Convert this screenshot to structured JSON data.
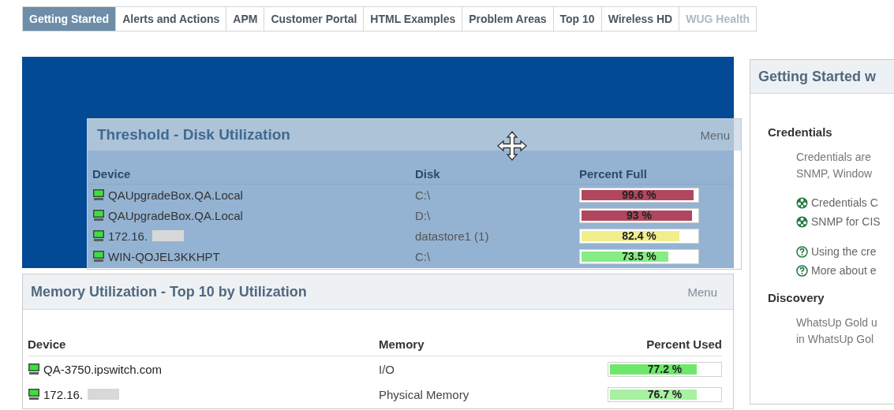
{
  "tabs": [
    {
      "label": "Getting Started",
      "selected": true
    },
    {
      "label": "Alerts and Actions",
      "selected": false
    },
    {
      "label": "APM",
      "selected": false
    },
    {
      "label": "Customer Portal",
      "selected": false
    },
    {
      "label": "HTML Examples",
      "selected": false
    },
    {
      "label": "Problem Areas",
      "selected": false
    },
    {
      "label": "Top 10",
      "selected": false
    },
    {
      "label": "Wireless HD",
      "selected": false
    },
    {
      "label": "WUG Health",
      "selected": false
    }
  ],
  "memory_panel": {
    "title": "Memory Utilization - Top 10 by Utilization",
    "menu": "Menu",
    "columns": [
      "Device",
      "Memory",
      "Percent Used"
    ],
    "rows": [
      {
        "device": "QA-3750.ipswitch.com",
        "redacted": false,
        "memory": "I/O",
        "reading": "77.2 %",
        "level": 0.772,
        "color": "#6ee86a"
      },
      {
        "device": "172.16.",
        "redacted": true,
        "memory": "Physical Memory",
        "reading": "76.7 %",
        "level": 0.767,
        "color": "#a8f0a2"
      }
    ]
  },
  "getting_started_panel": {
    "title": "Getting Started w",
    "sections": [
      {
        "heading": "Credentials",
        "lines": [
          "Credentials are",
          "SNMP, Window"
        ],
        "link_groups": [
          {
            "links": [
              {
                "kind": "video",
                "text": "Credentials C"
              },
              {
                "kind": "video",
                "text": "SNMP for CIS"
              }
            ]
          },
          {
            "links": [
              {
                "kind": "help",
                "text": "Using the cre"
              },
              {
                "kind": "help",
                "text": "More about e"
              }
            ]
          }
        ]
      },
      {
        "heading": "Discovery",
        "lines": [
          "WhatsUp Gold u",
          "in WhatsUp Gol"
        ]
      }
    ]
  },
  "floating_panel": {
    "title": "Threshold - Disk Utilization",
    "menu": "Menu",
    "columns": [
      "Device",
      "Disk",
      "Percent Full"
    ],
    "rows": [
      {
        "device": "QAUpgradeBox.QA.Local",
        "redacted": false,
        "disk": "C:\\",
        "reading": "99.6 %",
        "level": 0.996,
        "color": "#b0475e"
      },
      {
        "device": "QAUpgradeBox.QA.Local",
        "redacted": false,
        "disk": "D:\\",
        "reading": "93 %",
        "level": 0.93,
        "color": "#b0475e"
      },
      {
        "device": "172.16.",
        "redacted": true,
        "disk": "datastore1 (1)",
        "reading": "82.4 %",
        "level": 0.824,
        "color": "#f2ee8c"
      },
      {
        "device": "WIN-QOJEL3KKHPT",
        "redacted": false,
        "disk": "C:\\",
        "reading": "73.5 %",
        "level": 0.735,
        "color": "#86ec84"
      }
    ]
  }
}
